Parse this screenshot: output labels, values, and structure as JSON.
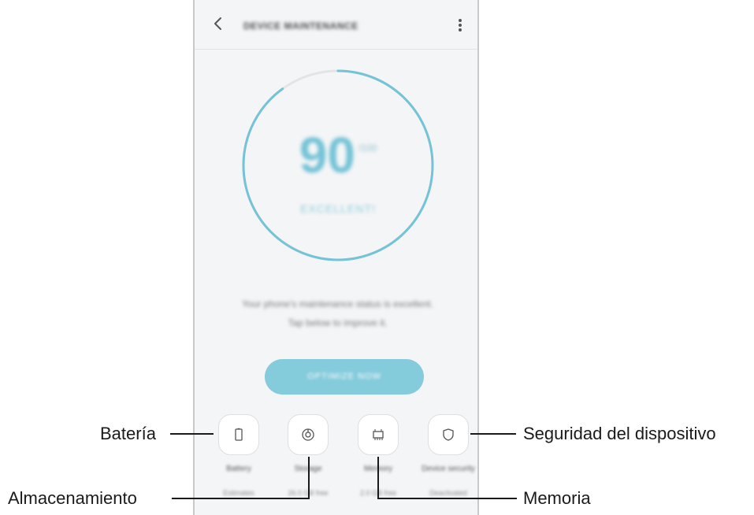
{
  "appbar": {
    "title": "DEVICE MAINTENANCE",
    "back_icon": "chevron-left-icon",
    "more_icon": "more-vertical-icon"
  },
  "score": {
    "value": "90",
    "unit": "/100",
    "status": "EXCELLENT!",
    "ring_progress": 0.9,
    "ring_color": "#74c3d6",
    "ring_track_color": "#e3e4e6"
  },
  "status_message": {
    "line1": "Your phone's maintenance status is excellent.",
    "line2": "Tap below to improve it."
  },
  "optimize_button": {
    "label": "OPTIMIZE NOW",
    "color": "#84cbdc"
  },
  "categories": [
    {
      "label": "Battery",
      "sub": "Estimates",
      "icon": "battery-icon"
    },
    {
      "label": "Storage",
      "sub": "26.0 GB free",
      "icon": "storage-icon"
    },
    {
      "label": "Memory",
      "sub": "2.0 GB free",
      "icon": "memory-chip-icon"
    },
    {
      "label": "Device security",
      "sub": "Deactivated",
      "icon": "shield-icon"
    }
  ],
  "callouts": {
    "battery": "Batería",
    "storage": "Almacenamiento",
    "security": "Seguridad del dispositivo",
    "memory": "Memoria"
  }
}
